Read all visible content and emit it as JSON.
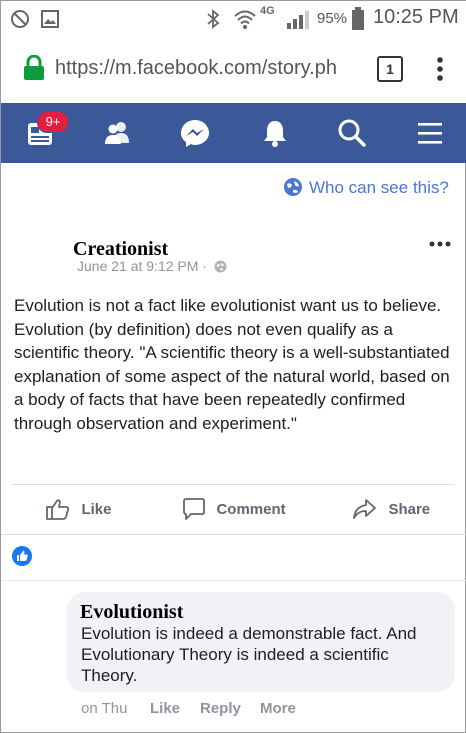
{
  "status_bar": {
    "network": "4G",
    "battery": "95%",
    "time": "10:25 PM"
  },
  "browser": {
    "url": "https://m.facebook.com/story.ph",
    "tab_count": "1"
  },
  "nav": {
    "notification_badge": "9+",
    "brand_color": "#3b5998"
  },
  "post": {
    "privacy_link": "Who can see this?",
    "author": "Creationist",
    "meta": "June 21 at 9:12 PM ·",
    "body": "Evolution is not a fact like evolutionist want us to believe. Evolution (by definition) does not even qualify as a scientific theory. \"A scientific theory is a well-substantiated explanation of some aspect of the natural world, based on a body of facts that have been repeatedly confirmed through observation and experiment.\"",
    "actions": {
      "like": "Like",
      "comment": "Comment",
      "share": "Share"
    }
  },
  "comment": {
    "author": "Evolutionist",
    "text": "Evolution is indeed a demonstrable fact. And Evolutionary Theory is indeed a scientific Theory.",
    "time": "on Thu",
    "like": "Like",
    "reply": "Reply",
    "more": "More"
  }
}
